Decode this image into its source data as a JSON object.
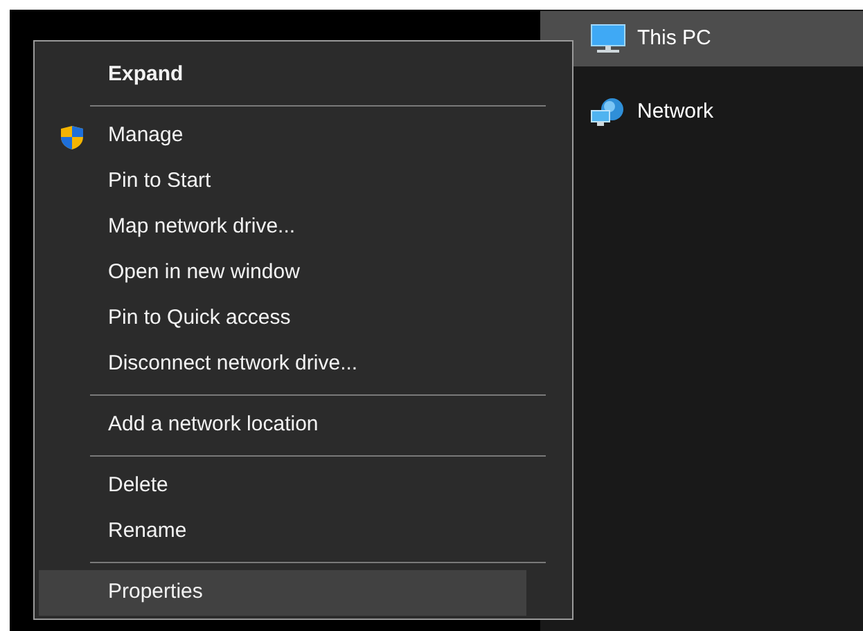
{
  "navigation_pane": {
    "items": [
      {
        "label": "This PC",
        "selected": true,
        "kind": "computer"
      },
      {
        "label": "Network",
        "selected": false,
        "kind": "network"
      }
    ]
  },
  "context_menu": {
    "entries": [
      {
        "kind": "item",
        "label": "Expand",
        "default": true,
        "elevated": false,
        "selected": false
      },
      {
        "kind": "separator"
      },
      {
        "kind": "item",
        "label": "Manage",
        "default": false,
        "elevated": true,
        "selected": false
      },
      {
        "kind": "item",
        "label": "Pin to Start",
        "default": false,
        "elevated": false,
        "selected": false
      },
      {
        "kind": "item",
        "label": "Map network drive...",
        "default": false,
        "elevated": false,
        "selected": false
      },
      {
        "kind": "item",
        "label": "Open in new window",
        "default": false,
        "elevated": false,
        "selected": false
      },
      {
        "kind": "item",
        "label": "Pin to Quick access",
        "default": false,
        "elevated": false,
        "selected": false
      },
      {
        "kind": "item",
        "label": "Disconnect network drive...",
        "default": false,
        "elevated": false,
        "selected": false
      },
      {
        "kind": "separator"
      },
      {
        "kind": "item",
        "label": "Add a network location",
        "default": false,
        "elevated": false,
        "selected": false
      },
      {
        "kind": "separator"
      },
      {
        "kind": "item",
        "label": "Delete",
        "default": false,
        "elevated": false,
        "selected": false
      },
      {
        "kind": "item",
        "label": "Rename",
        "default": false,
        "elevated": false,
        "selected": false
      },
      {
        "kind": "separator"
      },
      {
        "kind": "item",
        "label": "Properties",
        "default": false,
        "elevated": false,
        "selected": true
      }
    ]
  }
}
